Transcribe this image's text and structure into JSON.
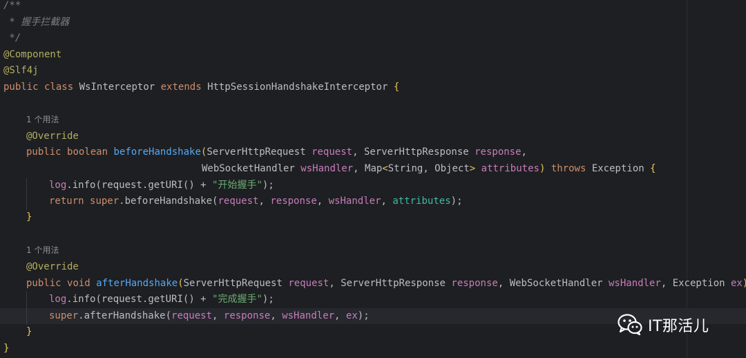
{
  "code": {
    "comment": {
      "open": "/**",
      "title": " * 握手拦截器",
      "close": " */"
    },
    "annotations": {
      "component": "@Component",
      "slf4j": "@Slf4j"
    },
    "class_decl": {
      "public": "public",
      "class": "class",
      "name": "WsInterceptor",
      "extends": "extends",
      "parent": "HttpSessionHandshakeInterceptor",
      "brace": "{"
    },
    "methods": [
      {
        "usage_hint": "1 个用法",
        "override": "@Override",
        "sig1": {
          "public": "public",
          "ret": "boolean",
          "name": "beforeHandshake",
          "p1_type": "ServerHttpRequest",
          "p1_name": "request",
          "p2_type": "ServerHttpResponse",
          "p2_name": "response"
        },
        "sig2": {
          "p3_type": "WebSocketHandler",
          "p3_name": "wsHandler",
          "p4_type_a": "Map",
          "p4_type_b": "String, Object",
          "p4_name": "attributes",
          "throws": "throws",
          "exc": "Exception",
          "brace": "{"
        },
        "log_line": {
          "log": "log",
          "info": ".info(",
          "req": "request",
          "call": ".getURI() + ",
          "str": "\"开始握手\"",
          "end": ");"
        },
        "ret_line": {
          "return": "return",
          "super": "super",
          "call": ".beforeHandshake(",
          "a1": "request",
          "a2": "response",
          "a3": "wsHandler",
          "a4": "attributes",
          "end": ");"
        },
        "close": "}"
      },
      {
        "usage_hint": "1 个用法",
        "override": "@Override",
        "sig1": {
          "public": "public",
          "ret": "void",
          "name": "afterHandshake",
          "p1_type": "ServerHttpRequest",
          "p1_name": "request",
          "p2_type": "ServerHttpResponse",
          "p2_name": "response",
          "p3_type": "WebSocketHandler",
          "p3_name": "wsHandler",
          "p4_type": "Exception",
          "p4_name": "ex",
          "brace": "{"
        },
        "log_line": {
          "log": "log",
          "info": ".info(",
          "req": "request",
          "call": ".getURI() + ",
          "str": "\"完成握手\"",
          "end": ");"
        },
        "super_line": {
          "super": "super",
          "call": ".afterHandshake(",
          "a1": "request",
          "a2": "response",
          "a3": "wsHandler",
          "a4": "ex",
          "end": ");"
        },
        "close": "}"
      }
    ],
    "class_close": "}"
  },
  "watermark": {
    "icon": "wechat-icon",
    "text": "IT那活儿"
  },
  "colors": {
    "background": "#1e1f22",
    "keyword": "#cf8e6d",
    "function": "#56a8f5",
    "string": "#6aab73",
    "annotation": "#b3ae60",
    "comment": "#7a7e85",
    "parameter": "#c77dbb"
  }
}
